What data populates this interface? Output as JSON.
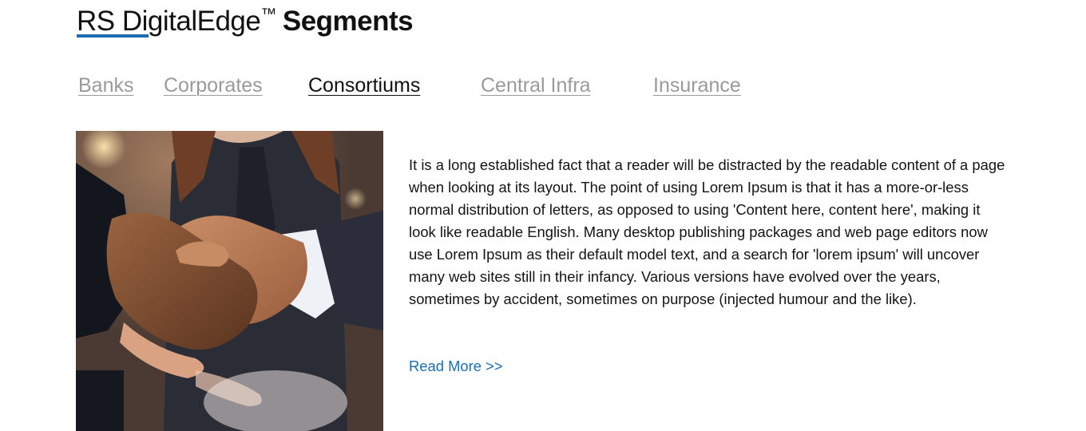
{
  "header": {
    "title_light": "RS DigitalEdge",
    "title_tm": "™",
    "title_bold": "Segments",
    "accent_color": "#1a6db1"
  },
  "tabs": [
    {
      "label": "Banks",
      "active": false
    },
    {
      "label": "Corporates",
      "active": false
    },
    {
      "label": "Consortiums",
      "active": true
    },
    {
      "label": "Central Infra",
      "active": false
    },
    {
      "label": "Insurance",
      "active": false
    }
  ],
  "main": {
    "image_icon": "handshake-photo",
    "body_text": "It is a long established fact that a reader will be distracted by the readable content of a page when looking at its layout. The point of using Lorem Ipsum is that it has a more-or-less normal distribution of letters, as opposed to using 'Content here, content here', making it look like readable English. Many desktop publishing packages and web page editors now use Lorem Ipsum as their default model text, and a search for 'lorem ipsum' will uncover many web sites still in their infancy. Various versions have evolved over the years, sometimes by accident, sometimes on purpose (injected humour and the like).",
    "read_more_label": "Read More >>"
  }
}
